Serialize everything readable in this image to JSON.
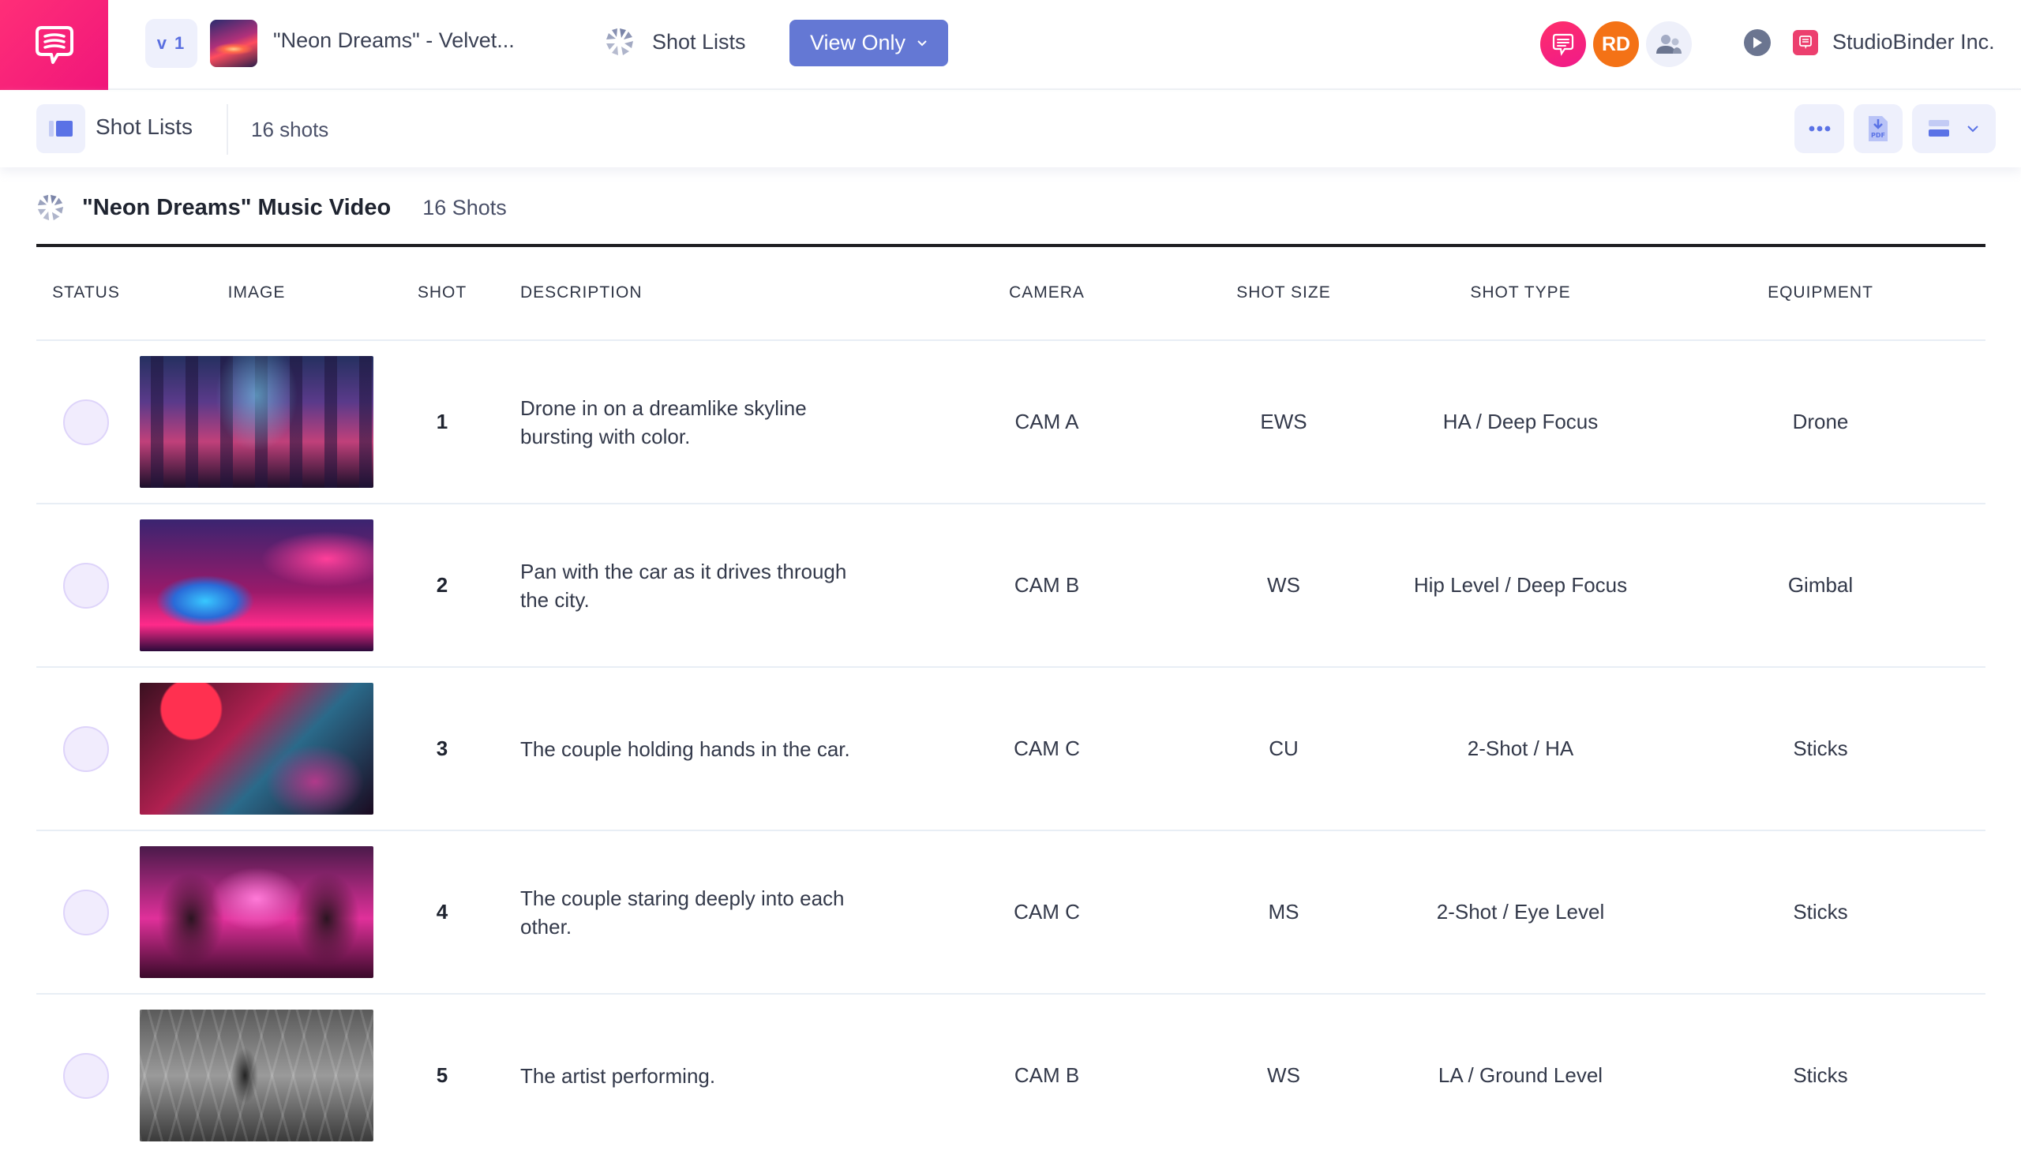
{
  "topbar": {
    "version": "v 1",
    "project_title": "\"Neon Dreams\" - Velvet...",
    "shotlists_label": "Shot Lists",
    "view_mode_label": "View Only",
    "user_initials": "RD",
    "company_name": "StudioBinder Inc.",
    "brand_color": "#F0167A",
    "accent_color": "#6478D4"
  },
  "subbar": {
    "title": "Shot Lists",
    "count": "16 shots",
    "icons": [
      "more-icon",
      "pdf-download-icon",
      "layout-icon",
      "chevron-down-icon"
    ]
  },
  "section": {
    "title": "\"Neon Dreams\" Music Video",
    "count": "16 Shots"
  },
  "table": {
    "columns": {
      "status": "STATUS",
      "image": "IMAGE",
      "shot": "SHOT",
      "description": "DESCRIPTION",
      "camera": "CAMERA",
      "shot_size": "SHOT SIZE",
      "shot_type": "SHOT TYPE",
      "equipment": "EQUIPMENT"
    },
    "rows": [
      {
        "shot": "1",
        "image": "neon-skyline",
        "description": "Drone in on a dreamlike skyline bursting with color.",
        "camera": "CAM A",
        "shot_size": "EWS",
        "shot_type": "HA / Deep Focus",
        "equipment": "Drone"
      },
      {
        "shot": "2",
        "image": "neon-car-street",
        "description": "Pan with the car as it drives through the city.",
        "camera": "CAM B",
        "shot_size": "WS",
        "shot_type": "Hip Level / Deep Focus",
        "equipment": "Gimbal"
      },
      {
        "shot": "3",
        "image": "holding-hands-car",
        "description": "The couple holding hands in the car.",
        "camera": "CAM C",
        "shot_size": "CU",
        "shot_type": "2-Shot / HA",
        "equipment": "Sticks"
      },
      {
        "shot": "4",
        "image": "couple-in-car",
        "description": "The couple staring deeply into each other.",
        "camera": "CAM C",
        "shot_size": "MS",
        "shot_type": "2-Shot / Eye Level",
        "equipment": "Sticks"
      },
      {
        "shot": "5",
        "image": "artist-performing",
        "description": "The artist performing.",
        "camera": "CAM B",
        "shot_size": "WS",
        "shot_type": "LA / Ground Level",
        "equipment": "Sticks"
      }
    ]
  }
}
